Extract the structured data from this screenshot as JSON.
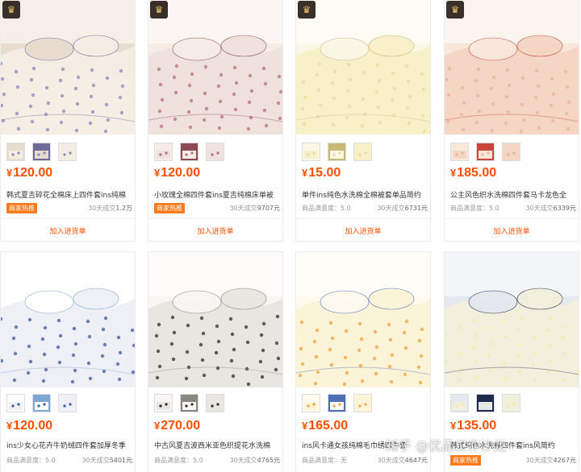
{
  "add_label": "加入进货单",
  "colors": {
    "accent": "#ff5000",
    "badge": "#ff7a1a"
  },
  "products": [
    {
      "price_symbol": "¥",
      "price": "120.00",
      "title": "韩式夏吉碎花全棉床上四件套ins纯棉",
      "badge": "商家热推",
      "rating": "",
      "sales_label": "30天成交",
      "sales_value": "1.2万",
      "palette": [
        "#f4ede4",
        "#8c87b6",
        "#e8dccd",
        "#6e6a9a"
      ]
    },
    {
      "price_symbol": "¥",
      "price": "120.00",
      "title": "小玫瑰全棉四件套ins夏吉纯棉床单被",
      "badge": "商家热推",
      "rating": "",
      "sales_label": "30天成交",
      "sales_value": "9707元",
      "palette": [
        "#efe1dc",
        "#b86f77",
        "#f5ece6",
        "#8e4a53"
      ]
    },
    {
      "price_symbol": "¥",
      "price": "15.00",
      "title": "单件ins纯色水洗棉全棉被套单品简约",
      "badge": "",
      "rating": "商品满意度：5.0",
      "sales_label": "30天成交",
      "sales_value": "6731元",
      "palette": [
        "#f7f0c8",
        "#e8dca4",
        "#fbf7e6",
        "#c9b778"
      ]
    },
    {
      "price_symbol": "¥",
      "price": "185.00",
      "title": "公主风色织水洗棉四件套马卡龙色全",
      "badge": "",
      "rating": "商品满意度：5.0",
      "sales_label": "30天成交",
      "sales_value": "6339元",
      "palette": [
        "#f5d6c4",
        "#e8b39a",
        "#f9e7dc",
        "#c8453c"
      ]
    },
    {
      "price_symbol": "¥",
      "price": "120.00",
      "title": "ins少女心花卉牛奶绒四件套加厚冬季",
      "badge": "",
      "rating": "商品满意度：5.0",
      "sales_label": "30天成交",
      "sales_value": "5401元",
      "palette": [
        "#eef0f6",
        "#3f5a9c",
        "#ffffff",
        "#7fa7d6"
      ]
    },
    {
      "price_symbol": "¥",
      "price": "270.00",
      "title": "中古风夏吉波西米亚色织提花水洗棉",
      "badge": "",
      "rating": "商品满意度：5.0",
      "sales_label": "30天成交",
      "sales_value": "4765元",
      "palette": [
        "#e9e6e1",
        "#2b2b2b",
        "#f8f6f2",
        "#8a8680"
      ]
    },
    {
      "price_symbol": "¥",
      "price": "165.00",
      "title": "ins风卡通女孩纯棉毛巾绣四件套",
      "badge": "",
      "rating": "商品满意度：无",
      "sales_label": "30天成交",
      "sales_value": "4647元",
      "palette": [
        "#fbf4d8",
        "#f2a33a",
        "#fffaf0",
        "#4d6fb5"
      ]
    },
    {
      "price_symbol": "¥",
      "price": "135.00",
      "title": "韩式纯色水洗棉四件套ins风简约",
      "badge": "商家热推",
      "rating": "",
      "sales_label": "30天成交",
      "sales_value": "4267元",
      "palette": [
        "#f2f0dc",
        "#f4e9a8",
        "#e4e8ef",
        "#1f2b4d"
      ]
    }
  ],
  "watermark": "知乎 @优品工作沙龙"
}
